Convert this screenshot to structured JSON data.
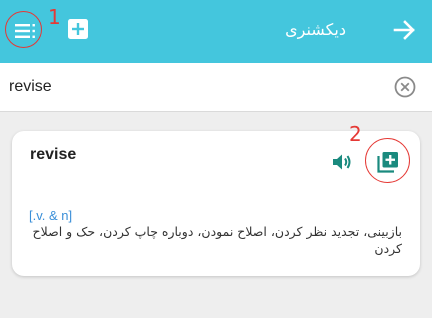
{
  "header": {
    "title": "دیکشنری",
    "icons": {
      "menu": "menu-icon",
      "add": "add-box-icon",
      "back": "arrow-right-icon"
    },
    "color": "#44c6dd"
  },
  "search": {
    "value": "revise",
    "clear_icon": "clear-circle-icon"
  },
  "result": {
    "word": "revise",
    "part_of_speech": "[.v. & n]",
    "definition": "بازبینی، تجدید نظر کردن، اصلاح نمودن، دوباره چاپ کردن، حک و اصلاح کردن",
    "icons": {
      "speaker": "speaker-icon",
      "add_to_list": "library-add-icon"
    },
    "accent_color": "#1a8a7e",
    "pos_color": "#3a8fd8"
  },
  "annotations": {
    "marker_1": "1",
    "marker_2": "2",
    "color": "#e53935"
  }
}
